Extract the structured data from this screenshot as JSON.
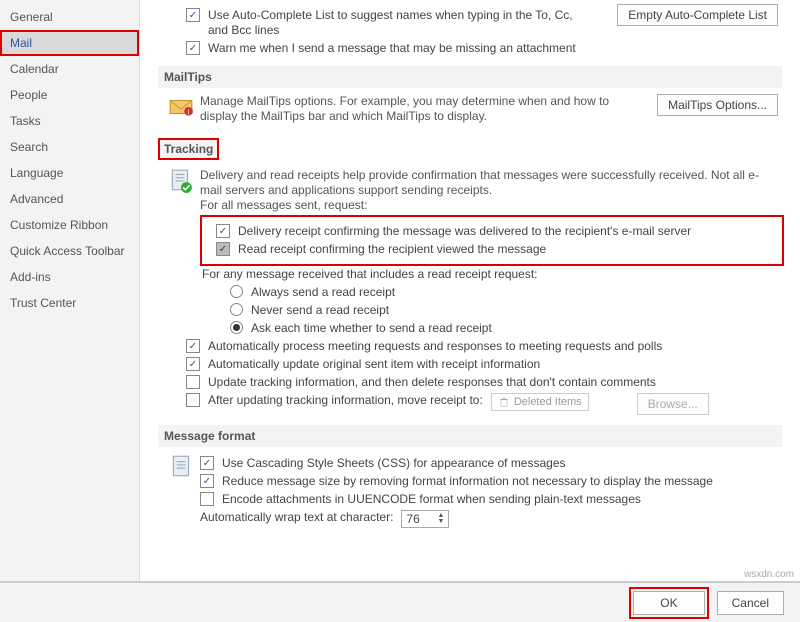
{
  "sidebar": {
    "items": [
      {
        "label": "General"
      },
      {
        "label": "Mail"
      },
      {
        "label": "Calendar"
      },
      {
        "label": "People"
      },
      {
        "label": "Tasks"
      },
      {
        "label": "Search"
      },
      {
        "label": "Language"
      },
      {
        "label": "Advanced"
      },
      {
        "label": "Customize Ribbon"
      },
      {
        "label": "Quick Access Toolbar"
      },
      {
        "label": "Add-ins"
      },
      {
        "label": "Trust Center"
      }
    ]
  },
  "autocomplete": {
    "chk1": "Use Auto-Complete List to suggest names when typing in the To, Cc, and Bcc lines",
    "btn": "Empty Auto-Complete List",
    "chk2": "Warn me when I send a message that may be missing an attachment"
  },
  "mailtips": {
    "heading": "MailTips",
    "desc": "Manage MailTips options. For example, you may determine when and how to display the MailTips bar and which MailTips to display.",
    "btn": "MailTips Options..."
  },
  "tracking": {
    "heading": "Tracking",
    "desc": "Delivery and read receipts help provide confirmation that messages were successfully received. Not all e-mail servers and applications support sending receipts.",
    "sub1": "For all messages sent, request:",
    "chk_delivery": "Delivery receipt confirming the message was delivered to the recipient's e-mail server",
    "chk_read": "Read receipt confirming the recipient viewed the message",
    "sub2": "For any message received that includes a read receipt request:",
    "r1": "Always send a read receipt",
    "r2": "Never send a read receipt",
    "r3": "Ask each time whether to send a read receipt",
    "chk_auto_process": "Automatically process meeting requests and responses to meeting requests and polls",
    "chk_auto_update": "Automatically update original sent item with receipt information",
    "chk_update_track": "Update tracking information, and then delete responses that don't contain comments",
    "chk_move_receipt": "After updating tracking information, move receipt to:",
    "deleted_items": "Deleted Items",
    "browse": "Browse..."
  },
  "msgformat": {
    "heading": "Message format",
    "chk_css": "Use Cascading Style Sheets (CSS) for appearance of messages",
    "chk_reduce": "Reduce message size by removing format information not necessary to display the message",
    "chk_uuencode": "Encode attachments in UUENCODE format when sending plain-text messages",
    "wrap_label": "Automatically wrap text at character:",
    "wrap_value": "76"
  },
  "footer": {
    "ok": "OK",
    "cancel": "Cancel"
  },
  "watermark": "wsxdn.com"
}
